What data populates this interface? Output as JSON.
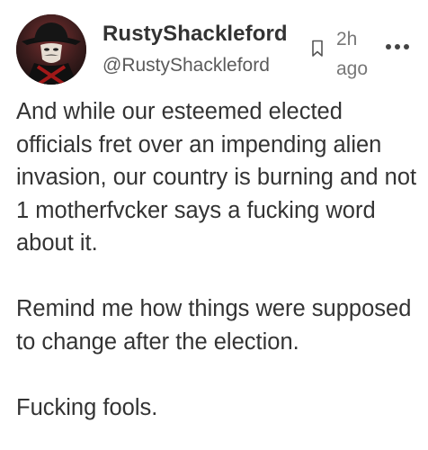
{
  "post": {
    "author": {
      "display_name": "RustyShackleford",
      "handle": "@RustyShackleford",
      "avatar_icon": "guy-fawkes-mask-avatar"
    },
    "timestamp": "2h ago",
    "actions": {
      "bookmark_icon": "bookmark-icon",
      "more_icon": "more-dots-icon"
    },
    "paragraphs": [
      "And while our esteemed elected officials fret over an impending alien invasion, our country is burning and not 1 motherfvcker says a fucking word about it.",
      "Remind me how things were supposed to change after the election.",
      "Fucking fools."
    ]
  },
  "colors": {
    "text": "#333333",
    "handle": "#5a5a5a",
    "muted": "#777777",
    "background": "#ffffff"
  }
}
